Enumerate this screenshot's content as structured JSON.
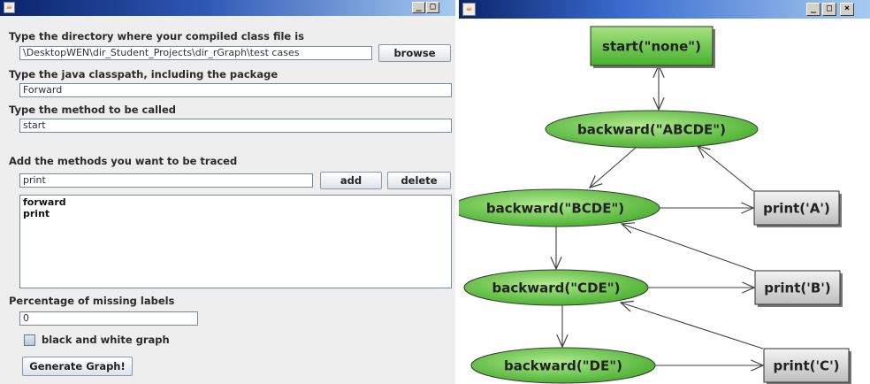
{
  "left_window": {
    "titlebar": {
      "icon": "java-cup-icon",
      "buttons": [
        "_",
        "□"
      ]
    },
    "directory": {
      "label": "Type the directory where your compiled class file is",
      "value": "\\DesktopWEN\\dir_Student_Projects\\dir_rGraph\\test cases",
      "browse_label": "browse"
    },
    "classpath": {
      "label": "Type the java classpath, including the package",
      "value": "Forward"
    },
    "method": {
      "label": "Type the method to be called",
      "value": "start"
    },
    "traced": {
      "label": "Add the methods you want to be traced",
      "value": "print",
      "add_label": "add",
      "delete_label": "delete",
      "items": [
        "forward",
        "print"
      ]
    },
    "missing": {
      "label": "Percentage of missing labels",
      "value": "0"
    },
    "bw": {
      "label": "black and white graph",
      "checked": false
    },
    "generate_label": "Generate Graph!"
  },
  "right_window": {
    "titlebar": {
      "icon": "java-cup-icon",
      "buttons": [
        "_",
        "□",
        "×"
      ]
    }
  },
  "graph": {
    "colors": {
      "node_green": "#5cc040",
      "node_gray": "#cfcfcf",
      "edge": "#404040"
    },
    "nodes": [
      {
        "id": "start",
        "label": "start(\"none\")",
        "shape": "rect",
        "fill": "green"
      },
      {
        "id": "b1",
        "label": "backward(\"ABCDE\")",
        "shape": "ellipse",
        "fill": "green"
      },
      {
        "id": "b2",
        "label": "backward(\"BCDE\")",
        "shape": "ellipse",
        "fill": "green"
      },
      {
        "id": "pA",
        "label": "print('A')",
        "shape": "rect",
        "fill": "gray"
      },
      {
        "id": "b3",
        "label": "backward(\"CDE\")",
        "shape": "ellipse",
        "fill": "green"
      },
      {
        "id": "pB",
        "label": "print('B')",
        "shape": "rect",
        "fill": "gray"
      },
      {
        "id": "b4",
        "label": "backward(\"DE\")",
        "shape": "ellipse",
        "fill": "green"
      },
      {
        "id": "pC",
        "label": "print('C')",
        "shape": "rect",
        "fill": "gray"
      }
    ],
    "edges": [
      {
        "from": "start",
        "to": "b1",
        "bidirectional": true
      },
      {
        "from": "b1",
        "to": "b2"
      },
      {
        "from": "b2",
        "to": "pA"
      },
      {
        "from": "pA",
        "to": "b1"
      },
      {
        "from": "b2",
        "to": "b3"
      },
      {
        "from": "b3",
        "to": "pB"
      },
      {
        "from": "pB",
        "to": "b2"
      },
      {
        "from": "b3",
        "to": "b4"
      },
      {
        "from": "b4",
        "to": "pC"
      },
      {
        "from": "pC",
        "to": "b3"
      }
    ]
  }
}
